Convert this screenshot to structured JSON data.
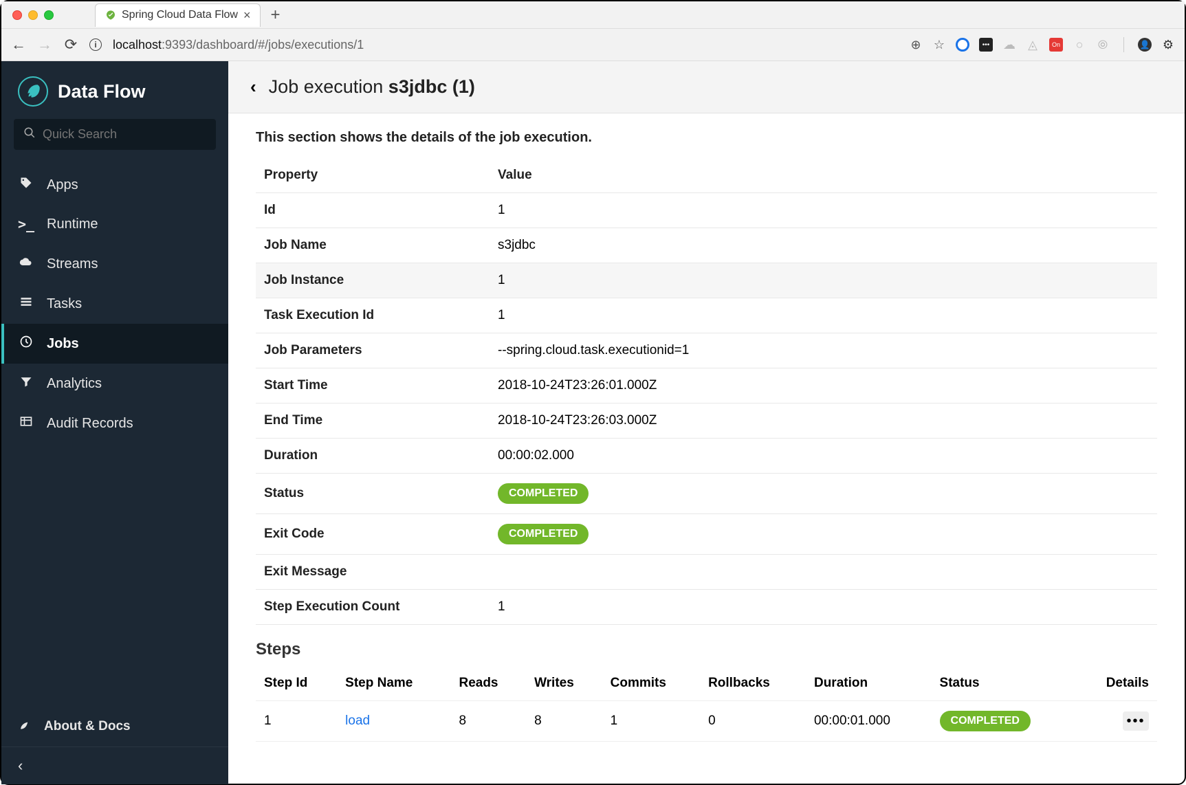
{
  "browser": {
    "tab_title": "Spring Cloud Data Flow",
    "url_prefix": "localhost",
    "url_rest": ":9393/dashboard/#/jobs/executions/1"
  },
  "brand": {
    "name": "Data Flow"
  },
  "search": {
    "placeholder": "Quick Search"
  },
  "sidebar": {
    "items": [
      {
        "icon": "tag-icon",
        "label": "Apps"
      },
      {
        "icon": "terminal-icon",
        "label": "Runtime"
      },
      {
        "icon": "cloud-icon",
        "label": "Streams"
      },
      {
        "icon": "list-icon",
        "label": "Tasks"
      },
      {
        "icon": "clock-icon",
        "label": "Jobs",
        "active": true
      },
      {
        "icon": "filter-icon",
        "label": "Analytics"
      },
      {
        "icon": "table-icon",
        "label": "Audit Records"
      }
    ],
    "about": "About & Docs"
  },
  "header": {
    "prefix": "Job execution ",
    "strong": "s3jdbc (1)"
  },
  "description": "This section shows the details of the job execution.",
  "details_table": {
    "headers": {
      "prop": "Property",
      "val": "Value"
    },
    "rows": [
      {
        "prop": "Id",
        "val": "1"
      },
      {
        "prop": "Job Name",
        "val": "s3jdbc"
      },
      {
        "prop": "Job Instance",
        "val": "1",
        "highlight": true
      },
      {
        "prop": "Task Execution Id",
        "val": "1"
      },
      {
        "prop": "Job Parameters",
        "val": "--spring.cloud.task.executionid=1"
      },
      {
        "prop": "Start Time",
        "val": "2018-10-24T23:26:01.000Z"
      },
      {
        "prop": "End Time",
        "val": "2018-10-24T23:26:03.000Z"
      },
      {
        "prop": "Duration",
        "val": "00:00:02.000"
      },
      {
        "prop": "Status",
        "val": "COMPLETED",
        "badge": true
      },
      {
        "prop": "Exit Code",
        "val": "COMPLETED",
        "badge": true
      },
      {
        "prop": "Exit Message",
        "val": ""
      },
      {
        "prop": "Step Execution Count",
        "val": "1"
      }
    ]
  },
  "steps_section": {
    "heading": "Steps",
    "headers": [
      "Step Id",
      "Step Name",
      "Reads",
      "Writes",
      "Commits",
      "Rollbacks",
      "Duration",
      "Status",
      "Details"
    ],
    "rows": [
      {
        "id": "1",
        "name": "load",
        "reads": "8",
        "writes": "8",
        "commits": "1",
        "rollbacks": "0",
        "duration": "00:00:01.000",
        "status": "COMPLETED"
      }
    ]
  }
}
